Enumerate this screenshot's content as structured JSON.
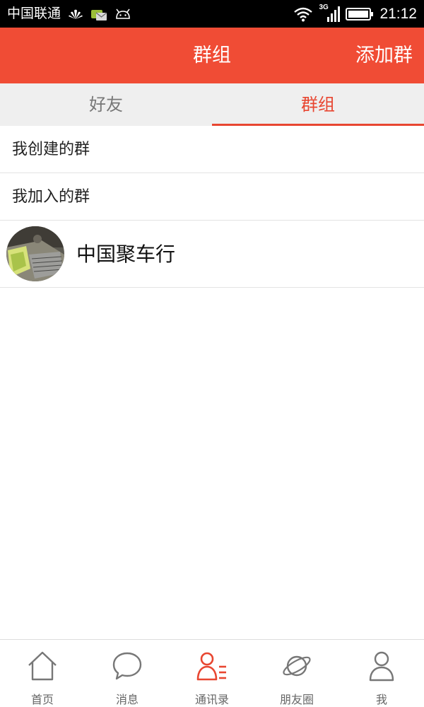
{
  "status_bar": {
    "carrier": "中国联通",
    "time": "21:12",
    "network": "3G"
  },
  "header": {
    "title": "群组",
    "action": "添加群"
  },
  "tabs": [
    {
      "label": "好友",
      "active": false
    },
    {
      "label": "群组",
      "active": true
    }
  ],
  "list": {
    "created_label": "我创建的群",
    "joined_label": "我加入的群",
    "groups": [
      {
        "name": "中国聚车行",
        "avatar_icon": "group-avatar-photo"
      }
    ]
  },
  "bottom_nav": [
    {
      "label": "首页",
      "icon": "home-icon",
      "active": false
    },
    {
      "label": "消息",
      "icon": "message-bubble-icon",
      "active": false
    },
    {
      "label": "通讯录",
      "icon": "contacts-icon",
      "active": true
    },
    {
      "label": "朋友圈",
      "icon": "planet-icon",
      "active": false
    },
    {
      "label": "我",
      "icon": "person-icon",
      "active": false
    }
  ],
  "colors": {
    "accent": "#f04c35",
    "tab_active": "#e84631",
    "icon_gray": "#777777"
  }
}
